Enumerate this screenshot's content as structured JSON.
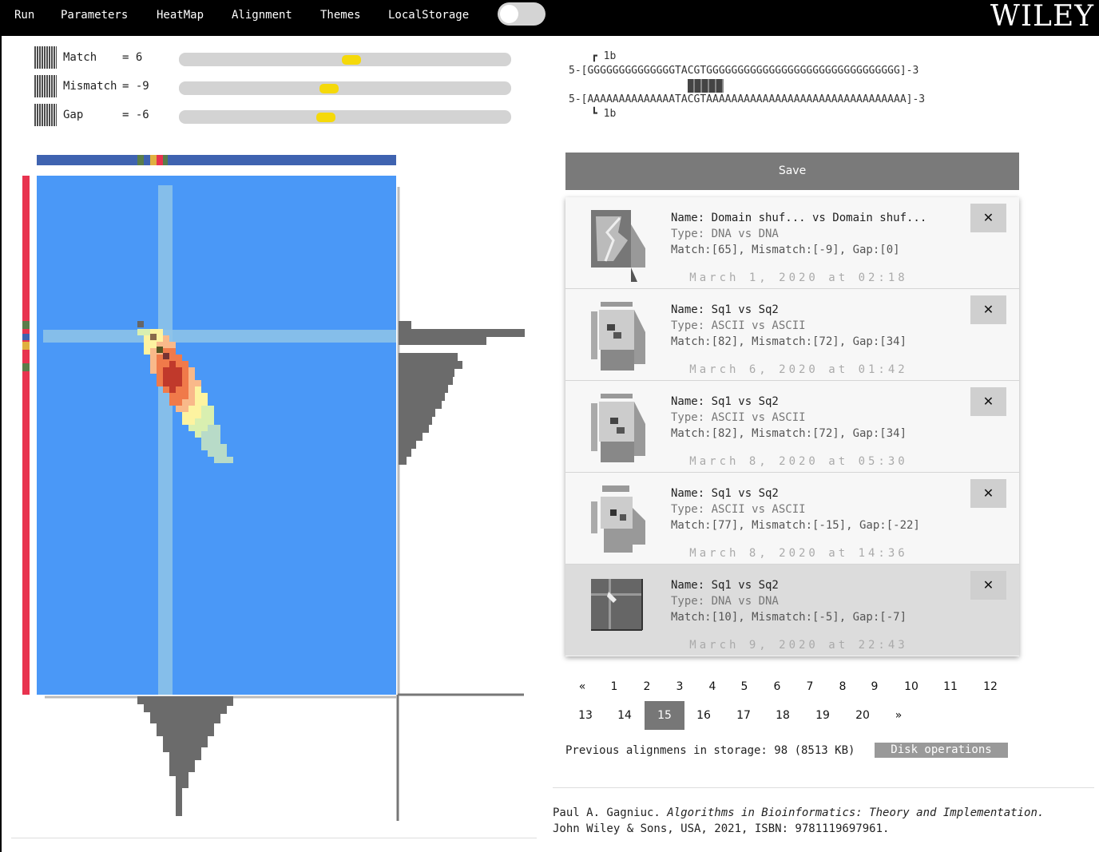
{
  "nav": {
    "run": "Run",
    "parameters": "Parameters",
    "heatmap": "HeatMap",
    "alignment": "Alignment",
    "themes": "Themes",
    "localstorage": "LocalStorage"
  },
  "logo": "WILEY",
  "params": [
    {
      "label": "Match",
      "value": "= 6",
      "level": 0.52
    },
    {
      "label": "Mismatch",
      "value": "= -9",
      "level": 0.45
    },
    {
      "label": "Gap",
      "value": "= -6",
      "level": 0.44
    }
  ],
  "sequence": {
    "top_marker": "┏ 1b",
    "seq1": "5-[GGGGGGGGGGGGGGTACGTGGGGGGGGGGGGGGGGGGGGGGGGGGGGGGG]-3",
    "seq2": "5-[AAAAAAAAAAAAAATACGTAAAAAAAAAAAAAAAAAAAAAAAAAAAAAAAA]-3",
    "bottom_marker": "┗ 1b"
  },
  "save_label": "Save",
  "items": [
    {
      "name": "Name: Domain shuf... vs Domain shuf...",
      "type": "Type: DNA vs DNA",
      "match": "Match:[65], Mismatch:[-9], Gap:[0]",
      "date": "March 1, 2020 at 02:18"
    },
    {
      "name": "Name: Sq1 vs Sq2",
      "type": "Type: ASCII vs ASCII",
      "match": "Match:[82], Mismatch:[72], Gap:[34]",
      "date": "March 6, 2020 at 01:42"
    },
    {
      "name": "Name: Sq1 vs Sq2",
      "type": "Type: ASCII vs ASCII",
      "match": "Match:[82], Mismatch:[72], Gap:[34]",
      "date": "March 8, 2020 at 05:30"
    },
    {
      "name": "Name: Sq1 vs Sq2",
      "type": "Type: ASCII vs ASCII",
      "match": "Match:[77], Mismatch:[-15], Gap:[-22]",
      "date": "March 8, 2020 at 14:36"
    },
    {
      "name": "Name: Sq1 vs Sq2",
      "type": "Type: DNA vs DNA",
      "match": "Match:[10], Mismatch:[-5], Gap:[-7]",
      "date": "March 9, 2020 at 22:43"
    }
  ],
  "close_label": "✕",
  "pagination": {
    "row1": [
      "«",
      "1",
      "2",
      "3",
      "4",
      "5",
      "6",
      "7",
      "8",
      "9",
      "10",
      "11",
      "12"
    ],
    "row2": [
      "13",
      "14",
      "15",
      "16",
      "17",
      "18",
      "19",
      "20",
      "»"
    ],
    "current": "15"
  },
  "storage_text": "Previous alignmens in storage: 98 (8513 KB)",
  "disk_label": "Disk operations",
  "citation": {
    "author": "Paul A. Gagniuc. ",
    "title": "Algorithms in Bioinformatics: Theory and Implementation.",
    "rest": "John Wiley & Sons, USA, 2021, ISBN: 9781119697961."
  },
  "colors": {
    "heatmap_bg": "#4a98f7",
    "accent_red": "#e8334f",
    "slider_thumb": "#f5d90a",
    "bar_blue": "#3f63b0"
  }
}
